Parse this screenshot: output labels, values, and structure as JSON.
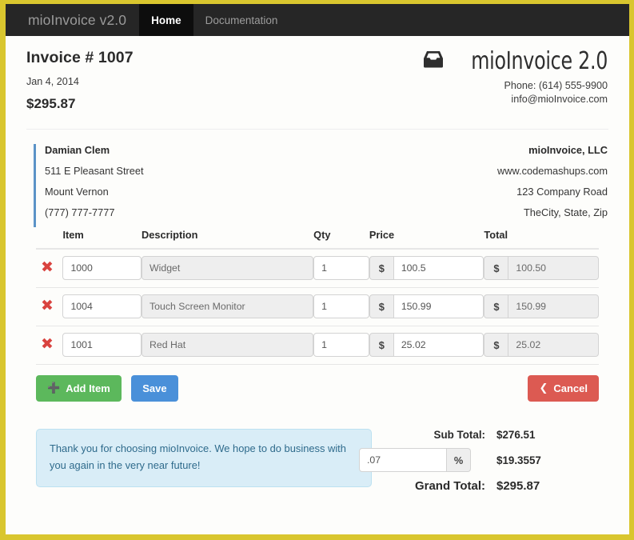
{
  "navbar": {
    "brand": "mioInvoice v2.0",
    "links": [
      {
        "label": "Home",
        "active": true
      },
      {
        "label": "Documentation",
        "active": false
      }
    ]
  },
  "invoice_header": {
    "title": "Invoice # 1007",
    "date": "Jan 4, 2014",
    "amount": "$295.87",
    "logo_text": "mioInvoice 2.0",
    "logo_icon": "inbox-tray-icon",
    "phone": "Phone: (614) 555-9900",
    "email": "info@mioInvoice.com"
  },
  "customer": {
    "name": "Damian Clem",
    "street": "511 E Pleasant Street",
    "city": "Mount Vernon",
    "phone": "(777) 777-7777",
    "accent_color": "#5b93c7"
  },
  "company": {
    "name": "mioInvoice, LLC",
    "website": "www.codemashups.com",
    "street": "123 Company Road",
    "city_state_zip": "TheCity, State, Zip"
  },
  "items_table": {
    "headers": [
      "",
      "Item",
      "Description",
      "Qty",
      "Price",
      "Total"
    ],
    "currency_symbol": "$",
    "delete_icon": "red-x-icon",
    "rows": [
      {
        "item": "1000",
        "description": "Widget",
        "qty": "1",
        "price": "100.5",
        "total": "100.50"
      },
      {
        "item": "1004",
        "description": "Touch Screen Monitor",
        "qty": "1",
        "price": "150.99",
        "total": "150.99"
      },
      {
        "item": "1001",
        "description": "Red Hat",
        "qty": "1",
        "price": "25.02",
        "total": "25.02"
      }
    ]
  },
  "actions": {
    "add_item": "Add Item",
    "add_item_icon": "plus-icon",
    "save": "Save",
    "cancel": "Cancel",
    "cancel_icon": "chevron-left-icon",
    "colors": {
      "add_item": "#5cb85c",
      "save": "#4a90d9",
      "cancel": "#dc5a52"
    }
  },
  "note": {
    "text": "Thank you for choosing mioInvoice. We hope to do business with you again in the very near future!",
    "background": "#d9edf7",
    "text_color": "#2f6b8c"
  },
  "totals": {
    "sub_total_label": "Sub Total:",
    "sub_total_value": "$276.51",
    "tax_rate": ".07",
    "tax_unit": "%",
    "tax_value": "$19.3557",
    "grand_total_label": "Grand Total:",
    "grand_total_value": "$295.87"
  },
  "window": {
    "border_color": "#d9c62e"
  }
}
